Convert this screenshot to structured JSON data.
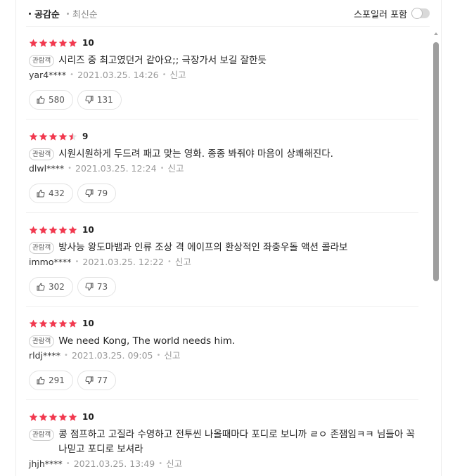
{
  "sort": {
    "options": [
      "공감순",
      "최신순"
    ],
    "active": 0
  },
  "spoiler": {
    "label": "스포일러 포함",
    "enabled": false
  },
  "colors": {
    "star": "#f2394f",
    "accent": "#222222",
    "muted": "#999999"
  },
  "reviews": [
    {
      "rating": 5,
      "score": "10",
      "badge": "관람객",
      "text": "시리즈 중 최고였던거 같아요;; 극장가서 보길 잘한듯",
      "author": "yar4****",
      "date": "2021.03.25. 14:26",
      "report": "신고",
      "likes": "580",
      "dislikes": "131"
    },
    {
      "rating": 4.5,
      "score": "9",
      "badge": "관람객",
      "text": "시원시원하게 두드려 패고 맞는 영화. 종종 봐줘야 마음이 상쾌해진다.",
      "author": "dlwl****",
      "date": "2021.03.25. 12:24",
      "report": "신고",
      "likes": "432",
      "dislikes": "79"
    },
    {
      "rating": 5,
      "score": "10",
      "badge": "관람객",
      "text": "방사능 왕도마뱀과 인류 조상 격 에이프의 환상적인 좌충우돌 액션 콜라보",
      "author": "immo****",
      "date": "2021.03.25. 12:22",
      "report": "신고",
      "likes": "302",
      "dislikes": "73"
    },
    {
      "rating": 5,
      "score": "10",
      "badge": "관람객",
      "text": "We need Kong, The world needs him.",
      "author": "rldj****",
      "date": "2021.03.25. 09:05",
      "report": "신고",
      "likes": "291",
      "dislikes": "77"
    },
    {
      "rating": 5,
      "score": "10",
      "badge": "관람객",
      "text": "콩 점프하고 고질라 수영하고 전투씬 나올때마다 포디로 보니까 ㄹㅇ 존잼임ㅋㅋ 님들아 꼭 나믿고 포디로 보셔라",
      "author": "jhjh****",
      "date": "2021.03.25. 13:49",
      "report": "신고",
      "likes": "",
      "dislikes": ""
    }
  ]
}
